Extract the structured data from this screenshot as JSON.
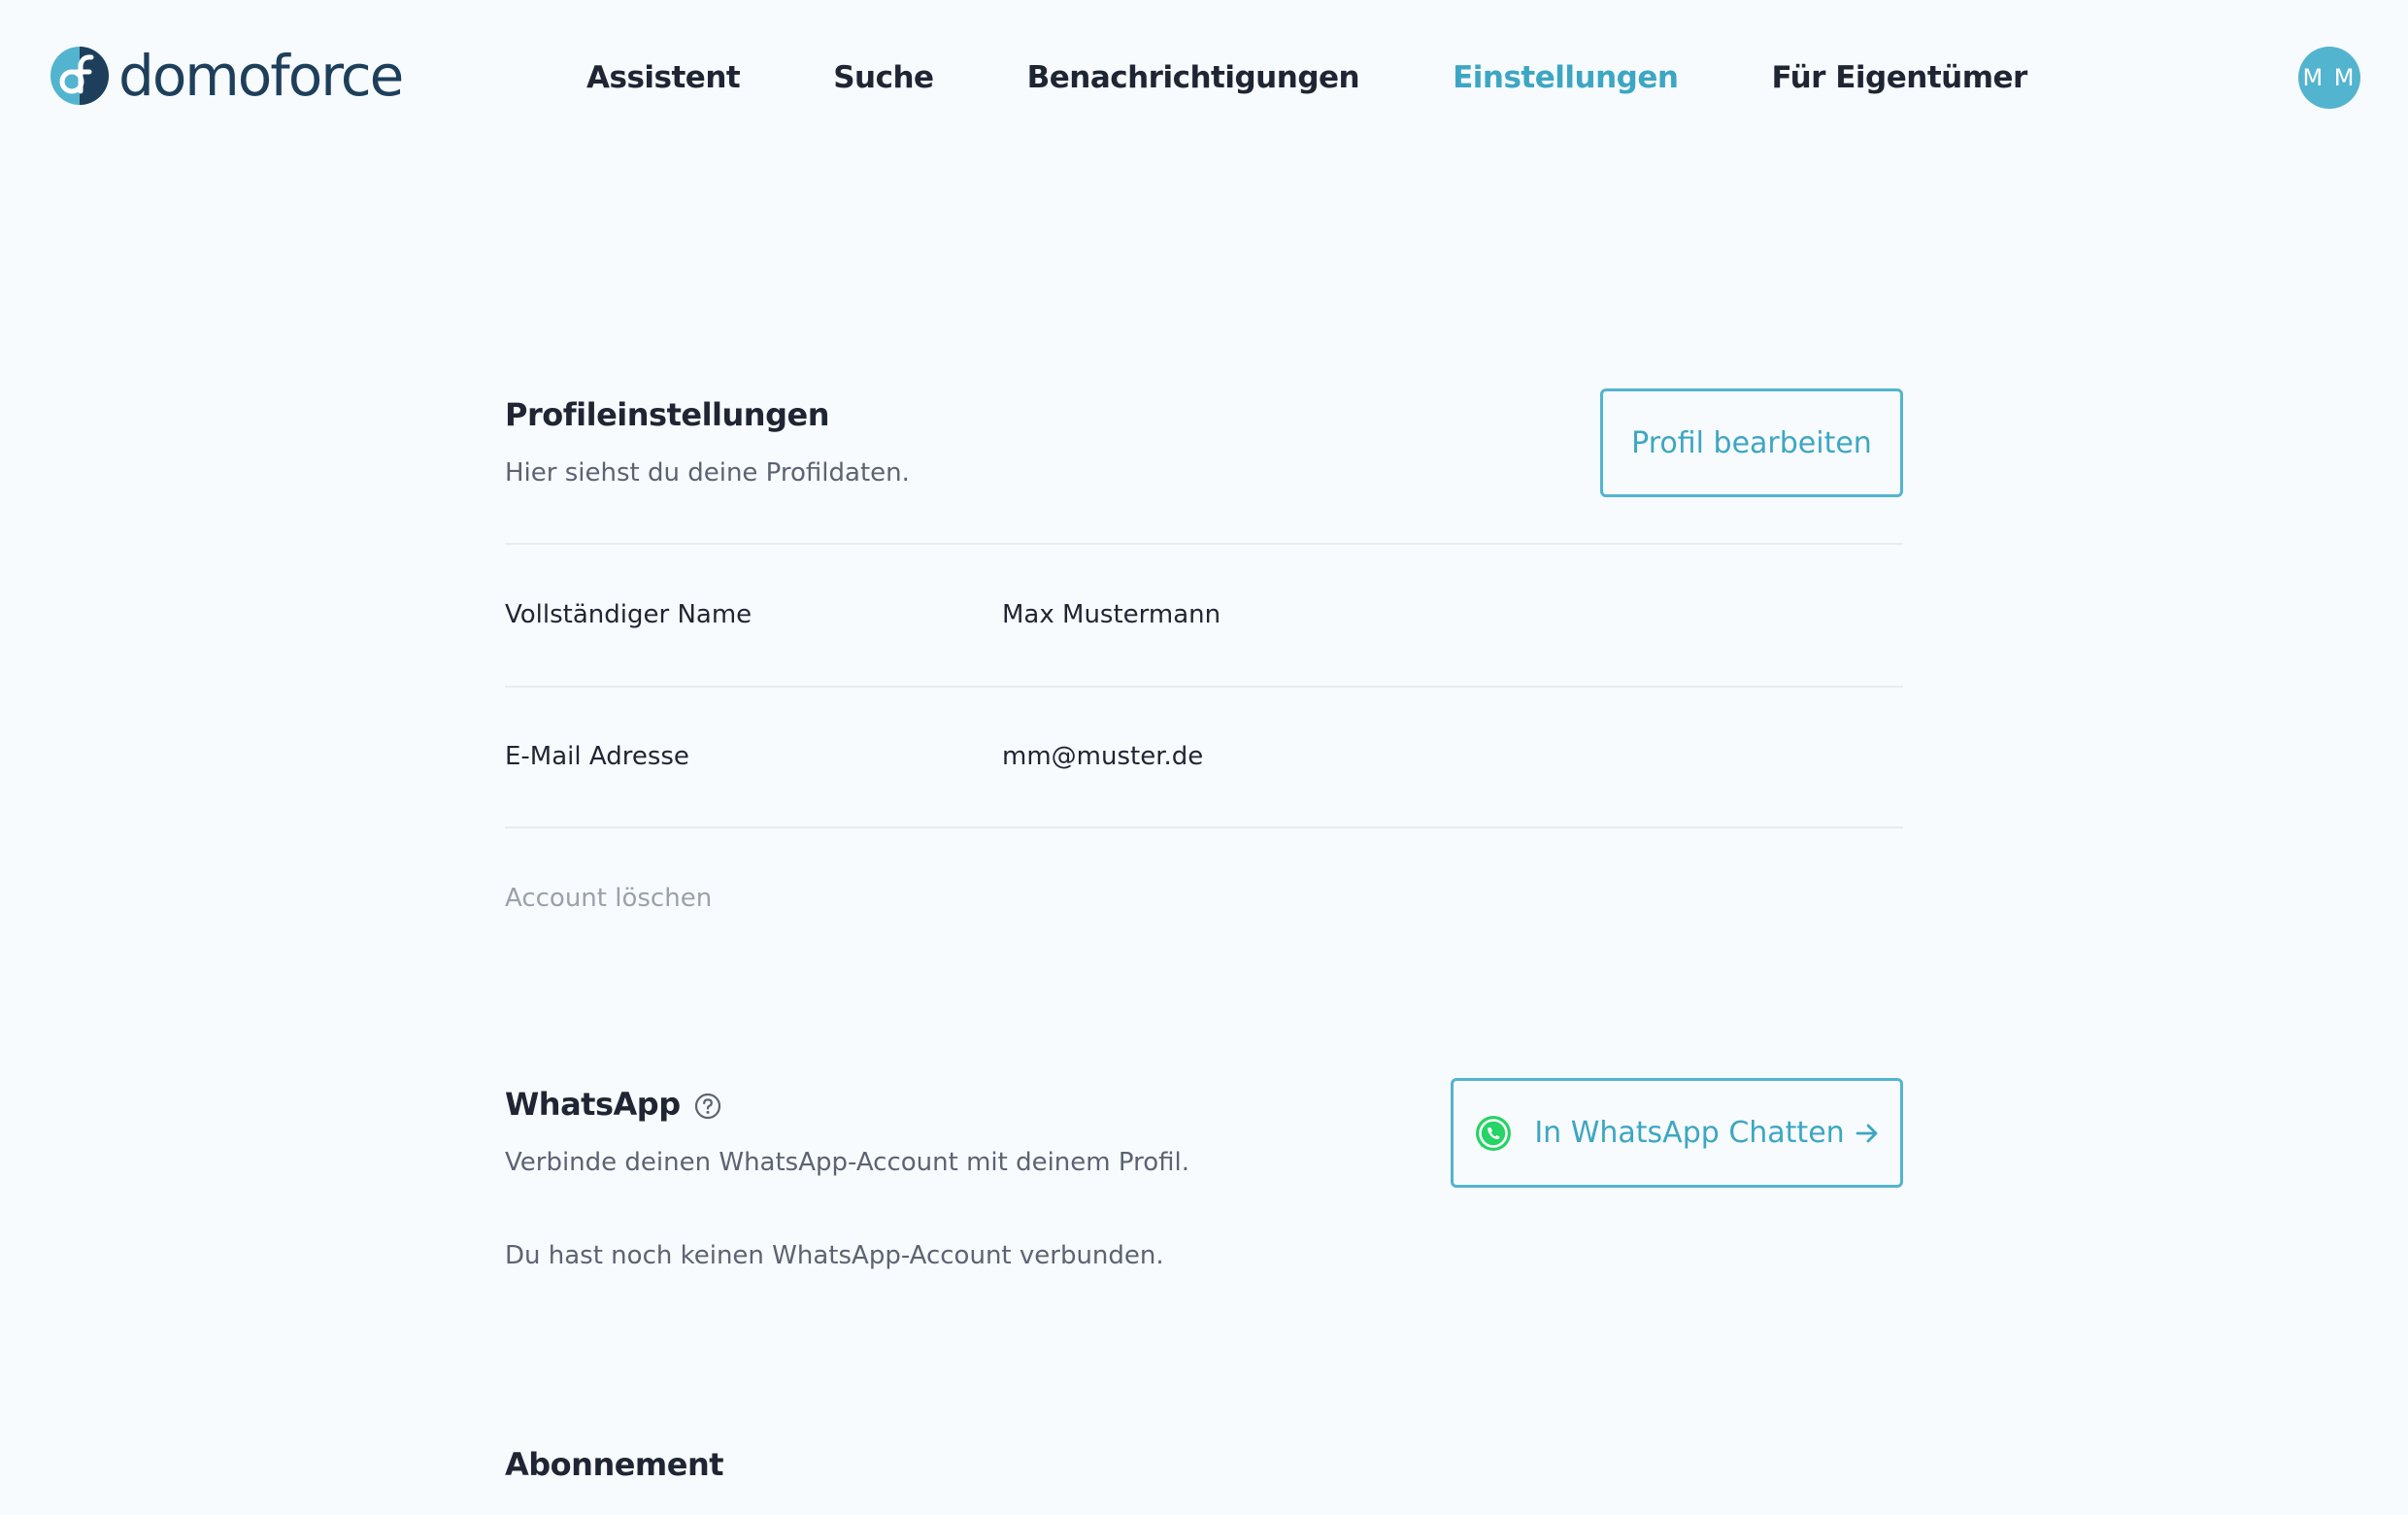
{
  "brand": {
    "name": "domoforce",
    "primary_color": "#53b4cf",
    "accent_text_color": "#3da6c3",
    "dark_color": "#1d3f5c"
  },
  "nav": {
    "items": [
      {
        "label": "Assistent",
        "active": false
      },
      {
        "label": "Suche",
        "active": false
      },
      {
        "label": "Benachrichtigungen",
        "active": false
      },
      {
        "label": "Einstellungen",
        "active": true
      },
      {
        "label": "Für Eigentümer",
        "active": false
      }
    ]
  },
  "user": {
    "initials": "M M"
  },
  "profile": {
    "title": "Profileinstellungen",
    "description": "Hier siehst du deine Profildaten.",
    "edit_button": "Profil bearbeiten",
    "fields": [
      {
        "label": "Vollständiger Name",
        "value": "Max Mustermann"
      },
      {
        "label": "E-Mail Adresse",
        "value": "mm@muster.de"
      }
    ],
    "delete_link": "Account löschen"
  },
  "whatsapp": {
    "title": "WhatsApp",
    "help_icon": "question-circle-icon",
    "description": "Verbinde deinen WhatsApp-Account mit deinem Profil.",
    "status": "Du hast noch keinen WhatsApp-Account verbunden.",
    "button_label": "In WhatsApp Chatten",
    "button_icon": "whatsapp-icon",
    "button_arrow": "arrow-right-icon",
    "icon_color": "#25d366"
  },
  "subscription": {
    "title": "Abonnement"
  }
}
